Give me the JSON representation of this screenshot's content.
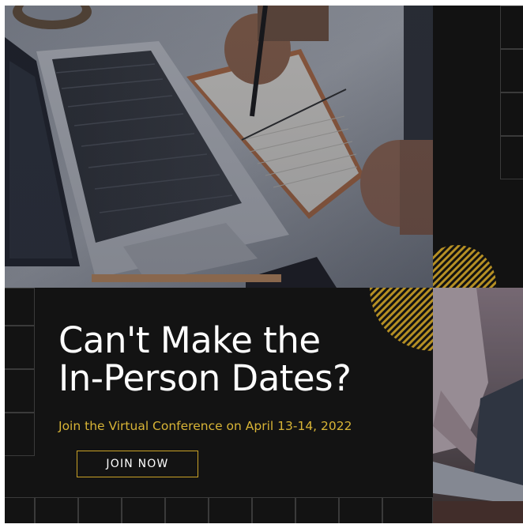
{
  "promo": {
    "headline_line1": "Can't Make the",
    "headline_line2": "In-Person Dates?",
    "subline": "Join the Virtual Conference on April 13-14, 2022",
    "cta_label": "JOIN NOW"
  },
  "colors": {
    "background": "#131313",
    "accent_gold": "#c9a227",
    "gridline": "#3a3a3a",
    "text": "#ffffff"
  },
  "images": {
    "main_photo": "desk-with-laptop-and-notebook-photo",
    "side_photo": "person-using-laptop-photo"
  }
}
